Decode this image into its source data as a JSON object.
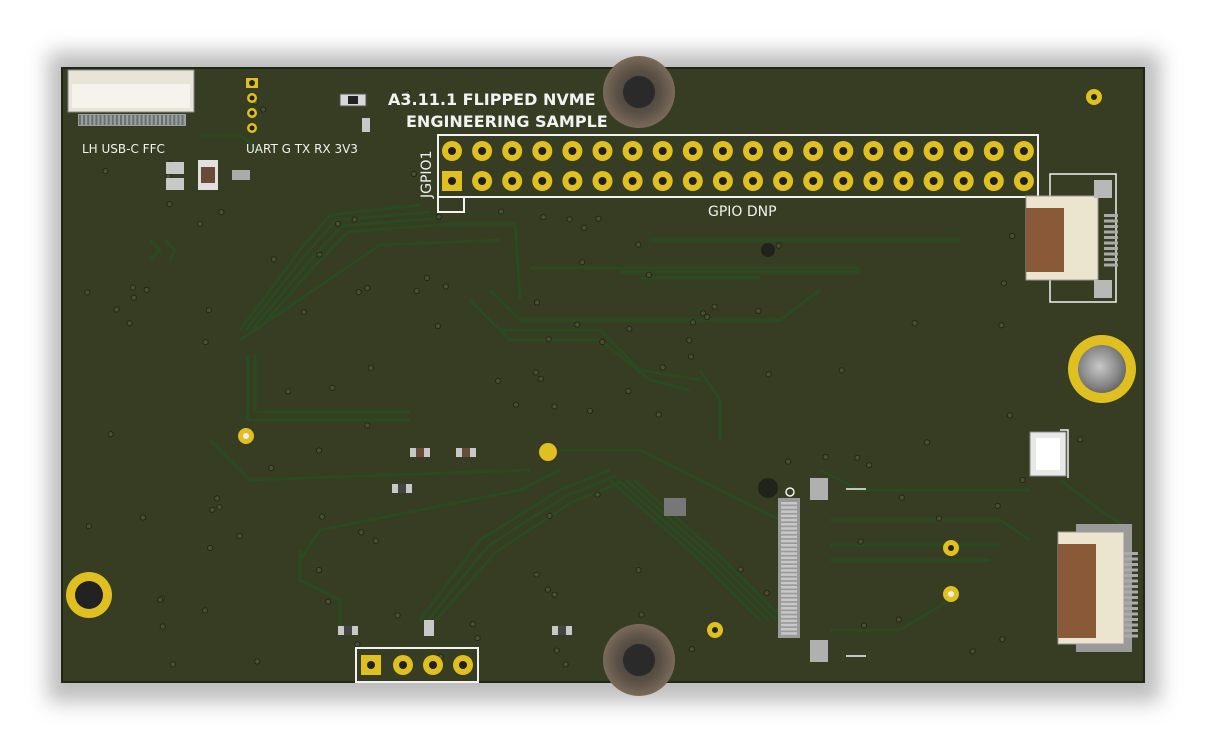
{
  "board": {
    "title_line1": "A3.11.1 FLIPPED NVME",
    "title_line2": "ENGINEERING SAMPLE",
    "ffc_label": "LH USB-C FFC",
    "uart_label": "UART G TX RX 3V3",
    "gpio_ref": "JGPIO1",
    "gpio_note": "GPIO DNP"
  },
  "colors": {
    "pcb": "#363d22",
    "trace": "#2a4a22",
    "silkscreen": "#f2f2f2",
    "pad_gold": "#e0c020",
    "background": "#ffffff"
  }
}
